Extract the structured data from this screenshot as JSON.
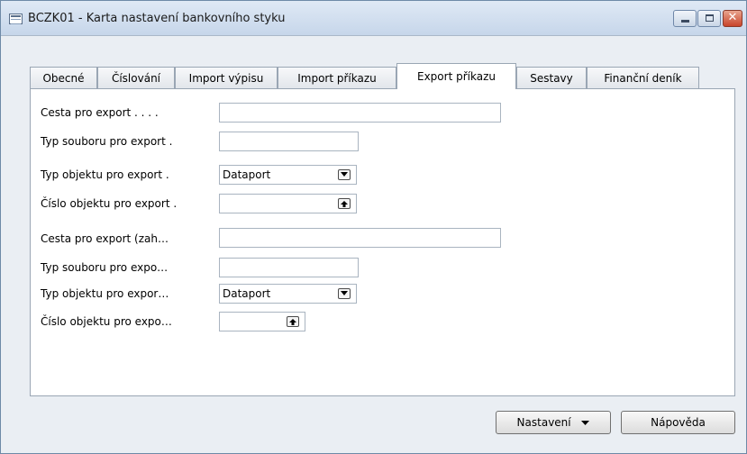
{
  "window": {
    "title": "BCZK01 - Karta nastavení bankovního styku"
  },
  "tabs": [
    {
      "label": "Obecné"
    },
    {
      "label": "Číslování"
    },
    {
      "label": "Import výpisu"
    },
    {
      "label": "Import příkazu"
    },
    {
      "label": "Export příkazu",
      "active": true
    },
    {
      "label": "Sestavy"
    },
    {
      "label": "Finanční deník"
    }
  ],
  "fields": {
    "cesta_export": {
      "label": "Cesta pro export . . . .",
      "value": ""
    },
    "typ_souboru_export": {
      "label": "Typ souboru pro export .",
      "value": ""
    },
    "typ_objektu_export": {
      "label": "Typ objektu pro export .",
      "value": "Dataport"
    },
    "cislo_objektu_export": {
      "label": "Číslo objektu pro export .",
      "value": ""
    },
    "cesta_export_zah": {
      "label": "Cesta pro export (zah…",
      "value": ""
    },
    "typ_souboru_expo": {
      "label": "Typ souboru pro expo…",
      "value": ""
    },
    "typ_objektu_expor": {
      "label": "Typ objektu pro expor…",
      "value": "Dataport"
    },
    "cislo_objektu_expo": {
      "label": "Číslo objektu pro expo…",
      "value": ""
    }
  },
  "buttons": {
    "nastaveni": "Nastavení",
    "napoveda": "Nápověda"
  }
}
